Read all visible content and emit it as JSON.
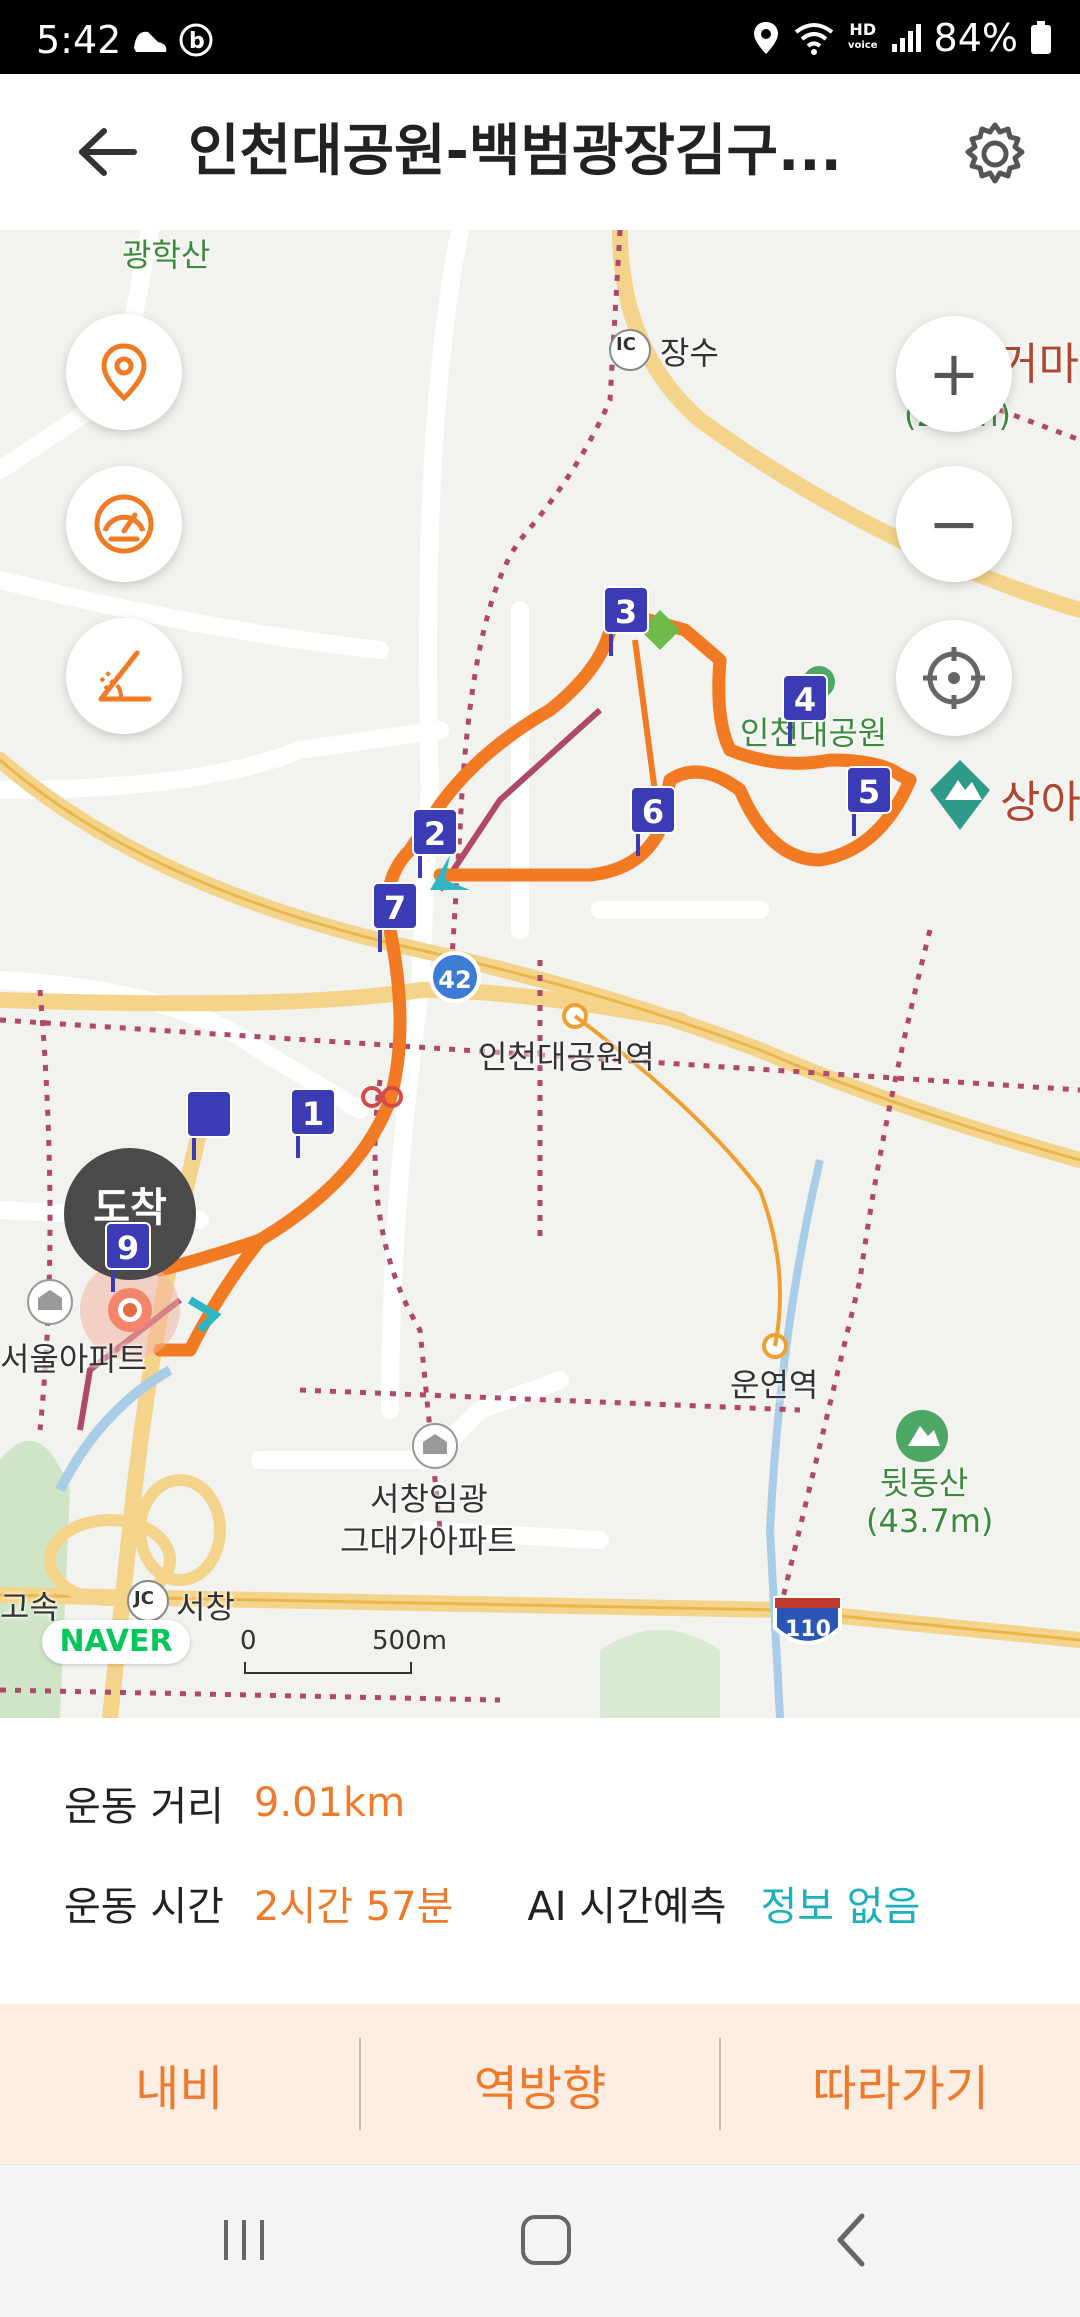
{
  "status_bar": {
    "time": "5:42",
    "battery": "84%",
    "hd_badge_top": "HD",
    "hd_badge_bottom": "voice"
  },
  "app_bar": {
    "title": "인천대공원-백범광장김구...",
    "back_icon": "arrow-left-icon",
    "settings_icon": "gear-icon"
  },
  "map": {
    "labels": {
      "gwanghaksan": "광학산",
      "jangsu": "장수",
      "ic_badge": "IC",
      "incheon_grand_park": "인천대공원",
      "sanga": "상아",
      "geomma": "거마",
      "geomma_height": "(22 m)",
      "route_42": "42",
      "incheon_grand_park_station": "인천대공원역",
      "unyeon_station": "운연역",
      "dwitdongsan": "뒷동산",
      "dwitdongsan_height": "(43.7m)",
      "seoul_apt": "서울아파트",
      "seochang_apt_line1": "서창임광",
      "seochang_apt_line2": "그대가아파트",
      "expressway": "고속",
      "jc_badge": "JC",
      "seochang": "서창",
      "route_110": "110",
      "destination_bubble": "도착"
    },
    "waypoints": [
      "1",
      "2",
      "3",
      "4",
      "5",
      "6",
      "7",
      "9"
    ],
    "naver_logo": "NAVER",
    "scale_start": "0",
    "scale_end": "500m",
    "fab_buttons": [
      "location-pin-icon",
      "speedometer-icon",
      "distance-ruler-icon"
    ],
    "zoom_in_label": "+",
    "zoom_out_label": "−",
    "colors": {
      "route": "#f27a23",
      "waypoint": "#3b3bb5",
      "map_bg": "#f2f2ef",
      "road_yellow": "#f3d48a",
      "boundary": "#b0486a"
    }
  },
  "summary": {
    "distance_label": "운동 거리",
    "distance_value": "9.01km",
    "time_label": "운동 시간",
    "time_value": "2시간 57분",
    "ai_label": "AI 시간예측",
    "ai_value": "정보 없음"
  },
  "actions": {
    "navi": "내비",
    "reverse": "역방향",
    "follow": "따라가기"
  },
  "nav_bar": {
    "recents_icon": "recents-icon",
    "home_icon": "home-icon",
    "back_icon": "back-chevron-icon"
  }
}
